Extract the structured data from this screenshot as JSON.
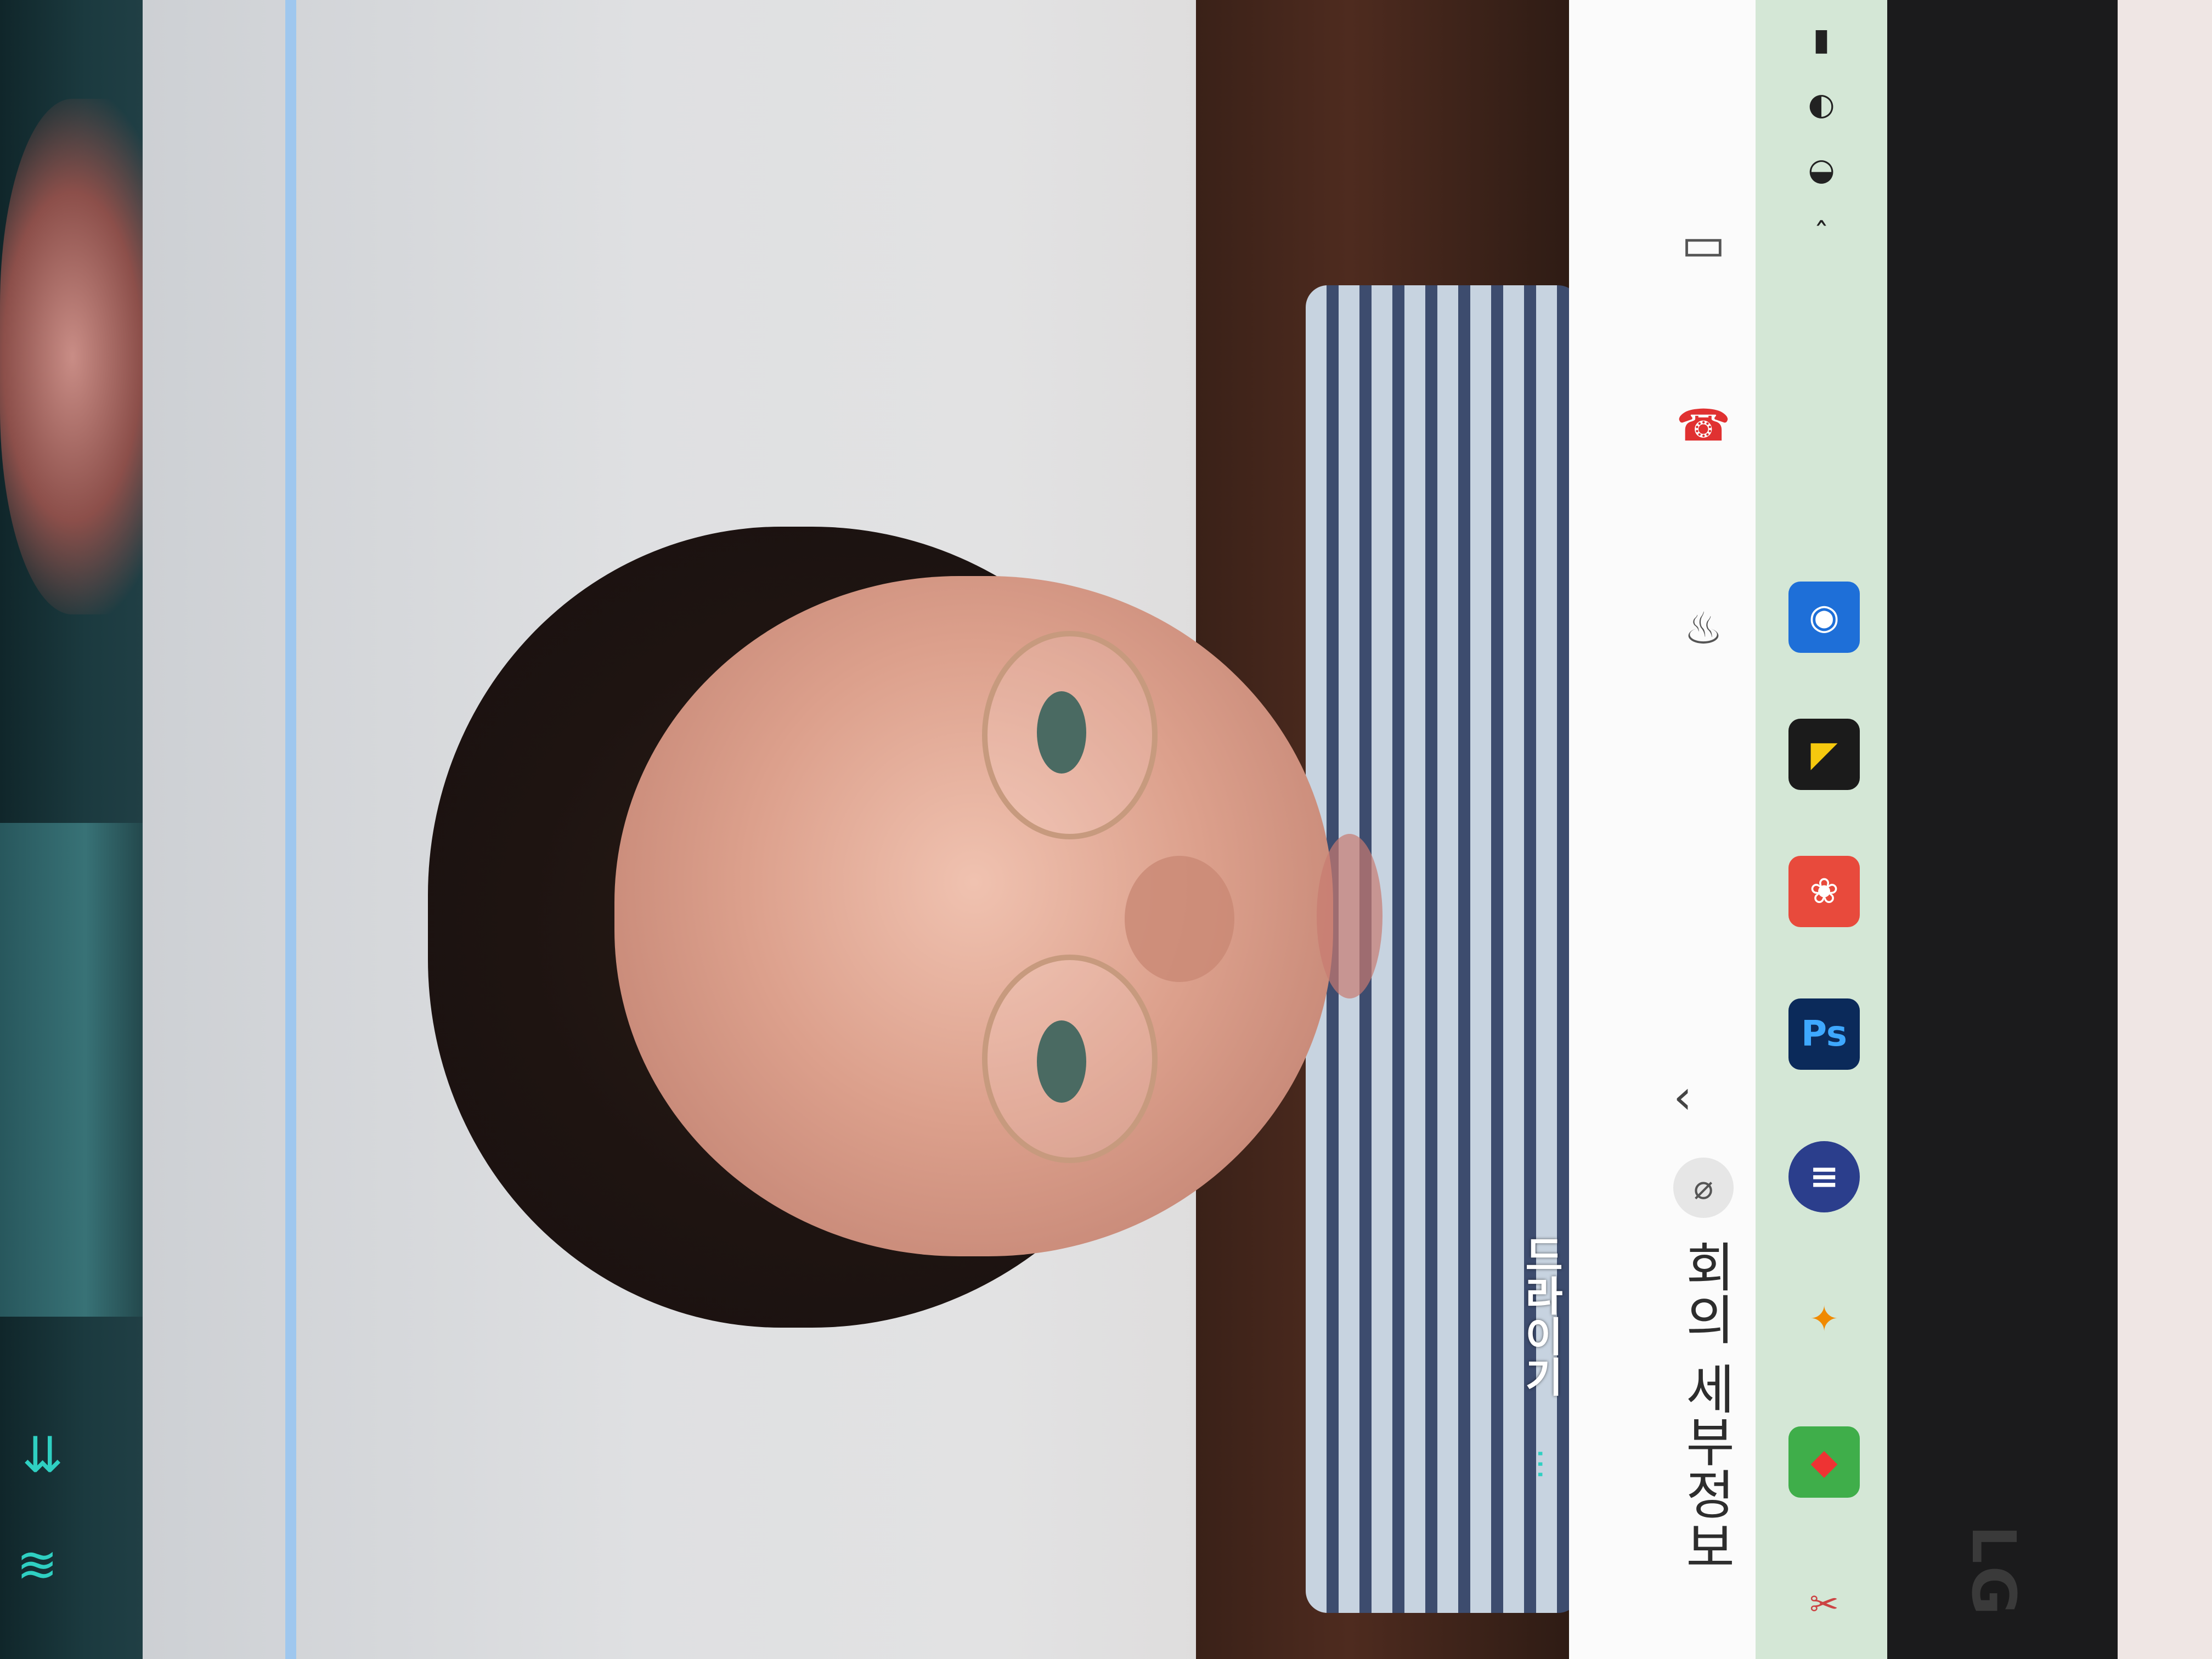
{
  "video_call": {
    "participant_name": "드라이기",
    "name_menu_dots": "···"
  },
  "control_bar": {
    "meeting_details_label": "회의 세부정보",
    "buttons": {
      "camera_icon": "camera-icon",
      "hangup_icon": "hang-up-icon",
      "mic_icon": "microphone-icon",
      "details_chevron_icon": "chevron-up-icon",
      "attach_icon": "paperclip-icon"
    }
  },
  "taskbar": {
    "apps": [
      {
        "name": "app-icon-1"
      },
      {
        "name": "app-icon-2"
      },
      {
        "name": "app-icon-3"
      },
      {
        "name": "photoshop",
        "label": "Ps"
      },
      {
        "name": "app-icon-5"
      },
      {
        "name": "app-icon-6"
      },
      {
        "name": "app-icon-7"
      },
      {
        "name": "app-icon-8"
      }
    ]
  },
  "monitor": {
    "brand": "LG"
  },
  "colors": {
    "accent_teal": "#2fd0c2",
    "hangup_red": "#e03131",
    "taskbar_green": "#d4e7d6",
    "control_bar_white": "#fbfbfb"
  }
}
